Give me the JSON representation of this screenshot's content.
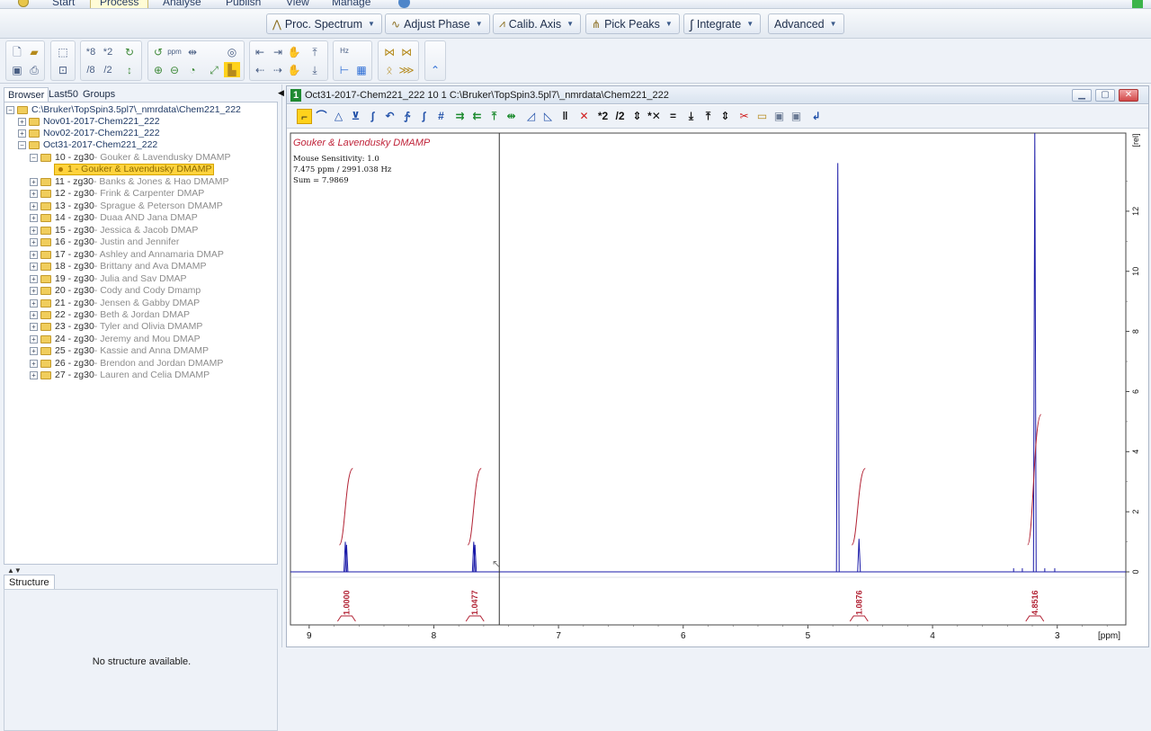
{
  "menu": {
    "tabs": [
      "Start",
      "Process",
      "Analyse",
      "Publish",
      "View",
      "Manage"
    ],
    "active": "Process"
  },
  "process_toolbar": [
    {
      "label": "Proc. Spectrum",
      "icon": "spectrum-icon"
    },
    {
      "label": "Adjust Phase",
      "icon": "phase-icon"
    },
    {
      "label": "Calib. Axis",
      "icon": "calibrate-icon"
    },
    {
      "label": "Pick Peaks",
      "icon": "pick-peaks-icon"
    },
    {
      "label": "Integrate",
      "icon": "integral-icon"
    },
    {
      "label": "Advanced",
      "icon": ""
    }
  ],
  "icon_toolbar": {
    "scale_labels": [
      "*8",
      "*2",
      "/8",
      "/2"
    ],
    "ppm_label": "ppm",
    "hz_label": "Hz"
  },
  "browser": {
    "tabs": [
      "Browser",
      "Last50",
      "Groups"
    ],
    "active_tab": "Browser",
    "root": "C:\\Bruker\\TopSpin3.5pl7\\_nmrdata\\Chem221_222",
    "folders": [
      "Nov01-2017-Chem221_222",
      "Nov02-2017-Chem221_222",
      "Oct31-2017-Chem221_222"
    ],
    "experiments": [
      {
        "num": "10 - zg30",
        "title": " - Gouker & Lavendusky DMAMP"
      },
      {
        "num": "11 - zg30",
        "title": " - Banks & Jones & Hao DMAMP"
      },
      {
        "num": "12 - zg30",
        "title": " - Frink & Carpenter DMAP"
      },
      {
        "num": "13 - zg30",
        "title": " - Sprague & Peterson DMAMP"
      },
      {
        "num": "14 - zg30",
        "title": " - Duaa AND Jana DMAP"
      },
      {
        "num": "15 - zg30",
        "title": " - Jessica & Jacob DMAP"
      },
      {
        "num": "16 - zg30",
        "title": " - Justin and Jennifer"
      },
      {
        "num": "17 - zg30",
        "title": " - Ashley and Annamaria DMAP"
      },
      {
        "num": "18 - zg30",
        "title": " - Brittany and Ava DMAMP"
      },
      {
        "num": "19 - zg30",
        "title": " - Julia and Sav DMAP"
      },
      {
        "num": "20 - zg30",
        "title": " - Cody and Cody Dmamp"
      },
      {
        "num": "21 - zg30",
        "title": " - Jensen & Gabby DMAP"
      },
      {
        "num": "22 - zg30",
        "title": " - Beth & Jordan DMAP"
      },
      {
        "num": "23 - zg30",
        "title": " - Tyler and Olivia DMAMP"
      },
      {
        "num": "24 - zg30",
        "title": " - Jeremy and Mou DMAP"
      },
      {
        "num": "25 - zg30",
        "title": " - Kassie and Anna DMAMP"
      },
      {
        "num": "26 - zg30",
        "title": " - Brendon and Jordan DMAMP"
      },
      {
        "num": "27 - zg30",
        "title": " - Lauren and Celia DMAMP"
      }
    ],
    "selected_proc": "1 - Gouker & Lavendusky DMAMP"
  },
  "structure": {
    "tab": "Structure",
    "empty_text": "No structure available."
  },
  "window": {
    "number": "1",
    "title": "Oct31-2017-Chem221_222  10  1  C:\\Bruker\\TopSpin3.5pl7\\_nmrdata\\Chem221_222"
  },
  "spectrum": {
    "title": "Gouker & Lavendusky DMAMP",
    "mouse_sensitivity": "Mouse Sensitivity: 1.0",
    "cursor_readout": "7.475 ppm / 2991.038 Hz",
    "sum_readout": "Sum = 7.9869",
    "x_unit": "[ppm]",
    "y_unit": "[rel]",
    "x_ticks": [
      "9",
      "8",
      "7",
      "6",
      "5",
      "4",
      "3"
    ],
    "y_ticks": [
      "12",
      "10",
      "8",
      "6",
      "4",
      "2",
      "0"
    ],
    "x_range_ppm": [
      9.15,
      2.45
    ],
    "y_range_rel": [
      -0.1,
      14.6
    ],
    "cursor_ppm": 7.475
  },
  "chart_data": {
    "type": "line",
    "title": "Gouker & Lavendusky DMAMP",
    "xlabel": "[ppm]",
    "ylabel": "[rel]",
    "xlim": [
      9.15,
      2.45
    ],
    "ylim": [
      -0.1,
      14.6
    ],
    "x_ticks": [
      9,
      8,
      7,
      6,
      5,
      4,
      3
    ],
    "y_ticks": [
      0,
      2,
      4,
      6,
      8,
      10,
      12
    ],
    "peaks": [
      {
        "ppm": 8.71,
        "height": 1.0
      },
      {
        "ppm": 8.7,
        "height": 0.9
      },
      {
        "ppm": 7.68,
        "height": 1.0
      },
      {
        "ppm": 7.67,
        "height": 0.9
      },
      {
        "ppm": 4.76,
        "height": 13.6
      },
      {
        "ppm": 4.59,
        "height": 1.1
      },
      {
        "ppm": 3.18,
        "height": 14.6
      }
    ],
    "integrals": [
      {
        "ppm": 8.7,
        "value": "1.0000"
      },
      {
        "ppm": 7.67,
        "value": "1.0477"
      },
      {
        "ppm": 4.59,
        "value": "1.0876"
      },
      {
        "ppm": 3.18,
        "value": "4.8516"
      }
    ]
  }
}
